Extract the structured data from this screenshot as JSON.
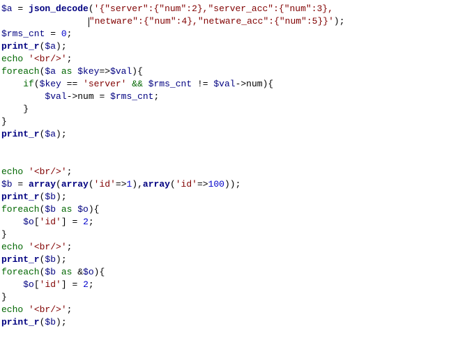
{
  "lines": {
    "l1": {
      "var_a": "$a",
      "assign": " = ",
      "fn": "json_decode",
      "open": "(",
      "str": "'{\"server\":{\"num\":2},\"server_acc\":{\"num\":3},",
      "end": ""
    },
    "l2": {
      "indent": "                ",
      "str": "\"netware\":{\"num\":4},\"netware_acc\":{\"num\":5}}'",
      "close": ");"
    },
    "l3": {
      "var": "$rms_cnt",
      "assign": " = ",
      "num": "0",
      "semi": ";"
    },
    "l4": {
      "fn": "print_r",
      "open": "(",
      "var": "$a",
      "close": ");"
    },
    "l5": {
      "kw": "echo",
      "sp": " ",
      "str": "'<br/>'",
      "semi": ";"
    },
    "l6": {
      "kw_foreach": "foreach",
      "open": "(",
      "var_a": "$a",
      "kw_as": " as ",
      "var_key": "$key",
      "arrow": "=>",
      "var_val": "$val",
      "close": "){"
    },
    "l7": {
      "indent": "    ",
      "kw_if": "if",
      "open": "(",
      "var_key": "$key",
      "eq": " == ",
      "str": "'server'",
      "and": " && ",
      "var_rms": "$rms_cnt",
      "neq": " != ",
      "var_val": "$val",
      "arrow": "->num){"
    },
    "l8": {
      "indent": "        ",
      "var_val": "$val",
      "arrow": "->num = ",
      "var_rms": "$rms_cnt",
      "semi": ";"
    },
    "l9": {
      "indent": "    ",
      "brace": "}"
    },
    "l10": {
      "brace": "}"
    },
    "l11": {
      "fn": "print_r",
      "open": "(",
      "var": "$a",
      "close": ");"
    },
    "l14": {
      "kw": "echo",
      "sp": " ",
      "str": "'<br/>'",
      "semi": ";"
    },
    "l15": {
      "var_b": "$b",
      "assign": " = ",
      "fn_array": "array",
      "open1": "(",
      "fn_array2": "array",
      "open2": "(",
      "str_id1": "'id'",
      "arrow1": "=>",
      "num1": "1",
      "close2": "),",
      "fn_array3": "array",
      "open3": "(",
      "str_id2": "'id'",
      "arrow2": "=>",
      "num2": "100",
      "close3": "));"
    },
    "l16": {
      "fn": "print_r",
      "open": "(",
      "var": "$b",
      "close": ");"
    },
    "l17": {
      "kw_foreach": "foreach",
      "open": "(",
      "var_b": "$b",
      "kw_as": " as ",
      "var_o": "$o",
      "close": "){"
    },
    "l18": {
      "indent": "    ",
      "var_o": "$o",
      "bracket_open": "[",
      "str": "'id'",
      "bracket_close": "] = ",
      "num": "2",
      "semi": ";"
    },
    "l19": {
      "brace": "}"
    },
    "l20": {
      "kw": "echo",
      "sp": " ",
      "str": "'<br/>'",
      "semi": ";"
    },
    "l21": {
      "fn": "print_r",
      "open": "(",
      "var": "$b",
      "close": ");"
    },
    "l22": {
      "kw_foreach": "foreach",
      "open": "(",
      "var_b": "$b",
      "kw_as": " as ",
      "amp": "&",
      "var_o": "$o",
      "close": "){"
    },
    "l23": {
      "indent": "    ",
      "var_o": "$o",
      "bracket_open": "[",
      "str": "'id'",
      "bracket_close": "] = ",
      "num": "2",
      "semi": ";"
    },
    "l24": {
      "brace": "}"
    },
    "l25": {
      "kw": "echo",
      "sp": " ",
      "str": "'<br/>'",
      "semi": ";"
    },
    "l26": {
      "fn": "print_r",
      "open": "(",
      "var": "$b",
      "close": ");"
    }
  }
}
